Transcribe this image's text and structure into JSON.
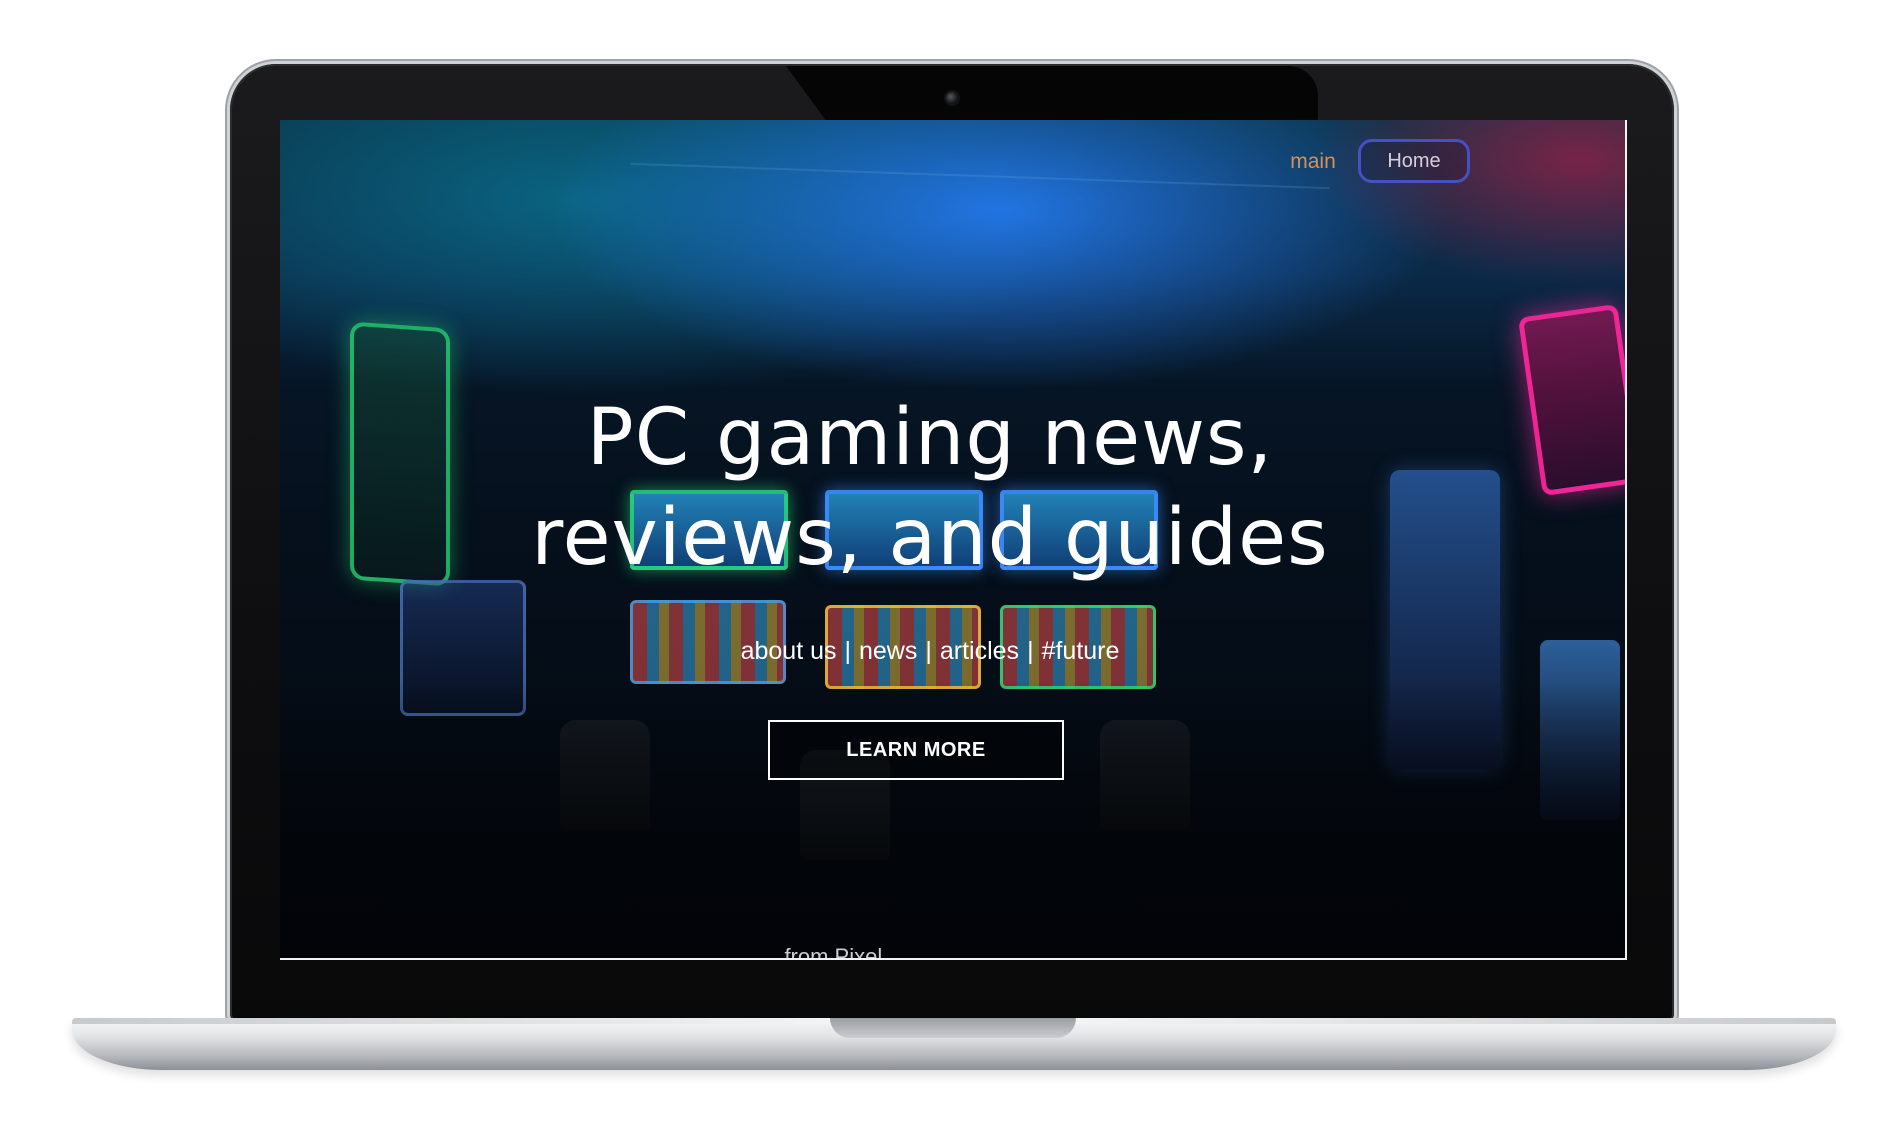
{
  "nav": {
    "main_label": "main",
    "home_label": "Home"
  },
  "hero": {
    "title_line1": "PC gaming news,",
    "title_line2": "reviews, and guides",
    "links": [
      "about us",
      "news",
      "articles",
      "#future"
    ],
    "separator": "|",
    "cta_label": "LEARN MORE",
    "cutoff_text": "... from Pixel ..."
  },
  "colors": {
    "nav_main_text": "#d3915e",
    "nav_home_border": "#4650c2",
    "hero_text": "#ffffff"
  }
}
